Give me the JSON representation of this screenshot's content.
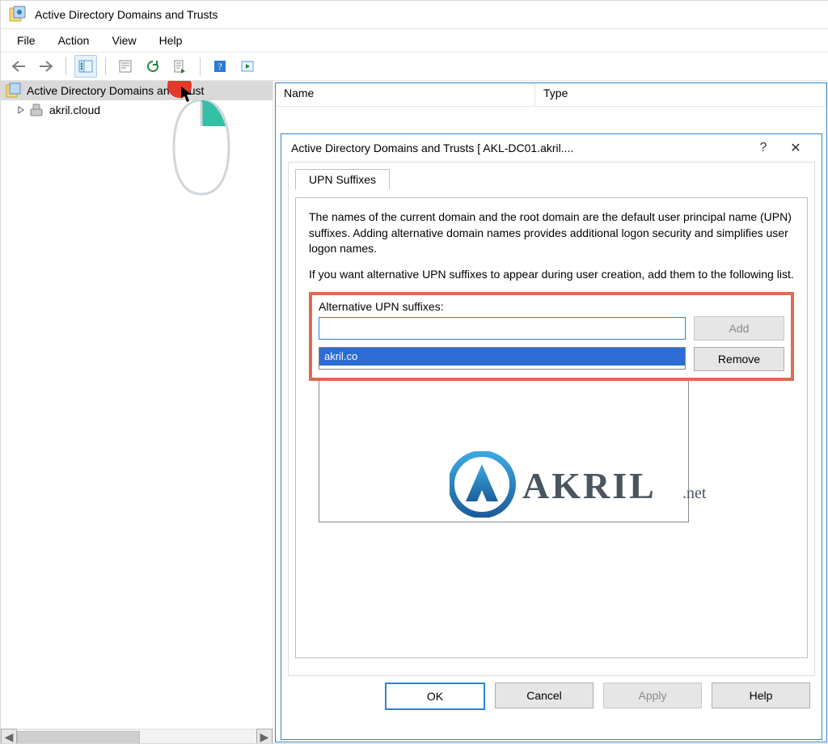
{
  "titlebar": {
    "title": "Active Directory Domains and Trusts"
  },
  "menubar": {
    "file": "File",
    "action": "Action",
    "view": "View",
    "help": "Help"
  },
  "tree": {
    "root": "Active Directory Domains and Trust",
    "child": "akril.cloud"
  },
  "columns": {
    "name": "Name",
    "type": "Type"
  },
  "dialog": {
    "title": "Active Directory Domains and Trusts [ AKL-DC01.akril....",
    "help_glyph": "?",
    "close_glyph": "✕",
    "tab": "UPN Suffixes",
    "desc1": "The names of the current domain and the root domain are the default user principal name (UPN) suffixes. Adding alternative domain names provides additional logon security and simplifies user logon names.",
    "desc2": "If you want alternative UPN suffixes to appear during user creation, add them to the following list.",
    "label": "Alternative UPN suffixes:",
    "input_value": "",
    "list_item": "akril.co",
    "add": "Add",
    "remove": "Remove",
    "ok": "OK",
    "cancel": "Cancel",
    "apply": "Apply",
    "help": "Help"
  },
  "watermark": {
    "brand_main": "AKRIL",
    "brand_suffix": ".net"
  }
}
